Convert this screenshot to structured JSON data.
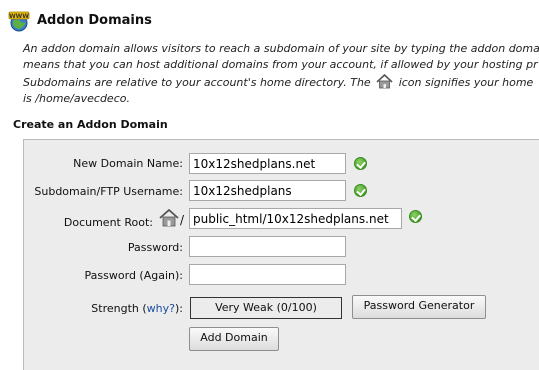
{
  "header": {
    "icon": "www-addon-icon",
    "title": "Addon Domains"
  },
  "description": {
    "line1": "An addon domain allows visitors to reach a subdomain of your site by typing the addon domai",
    "line2": "means that you can host additional domains from your account, if allowed by your hosting pr",
    "line3a": "Subdomains are relative to your account's home directory. The",
    "line3b": "icon signifies your home",
    "line4": "is /home/avecdeco."
  },
  "section_title": "Create an Addon Domain",
  "form": {
    "new_domain": {
      "label": "New Domain Name:",
      "value": "10x12shedplans.net",
      "status_icon": "green-check-icon"
    },
    "subdomain": {
      "label": "Subdomain/FTP Username:",
      "value": "10x12shedplans",
      "status_icon": "green-check-icon"
    },
    "document_root": {
      "label": "Document Root:",
      "prefix": "/",
      "value": "public_html/10x12shedplans.net",
      "status_icon": "green-check-icon"
    },
    "password": {
      "label": "Password:",
      "value": ""
    },
    "password_again": {
      "label": "Password (Again):",
      "value": ""
    },
    "strength": {
      "label": "Strength",
      "open_paren": "(",
      "help_link": "why?",
      "close": "):",
      "value": "Very Weak (0/100)"
    },
    "password_generator_button": "Password Generator",
    "add_domain_button": "Add Domain"
  },
  "colors": {
    "panel_bg": "#ececec",
    "link": "#1a4fa0",
    "ok_green": "#4ea82c"
  }
}
